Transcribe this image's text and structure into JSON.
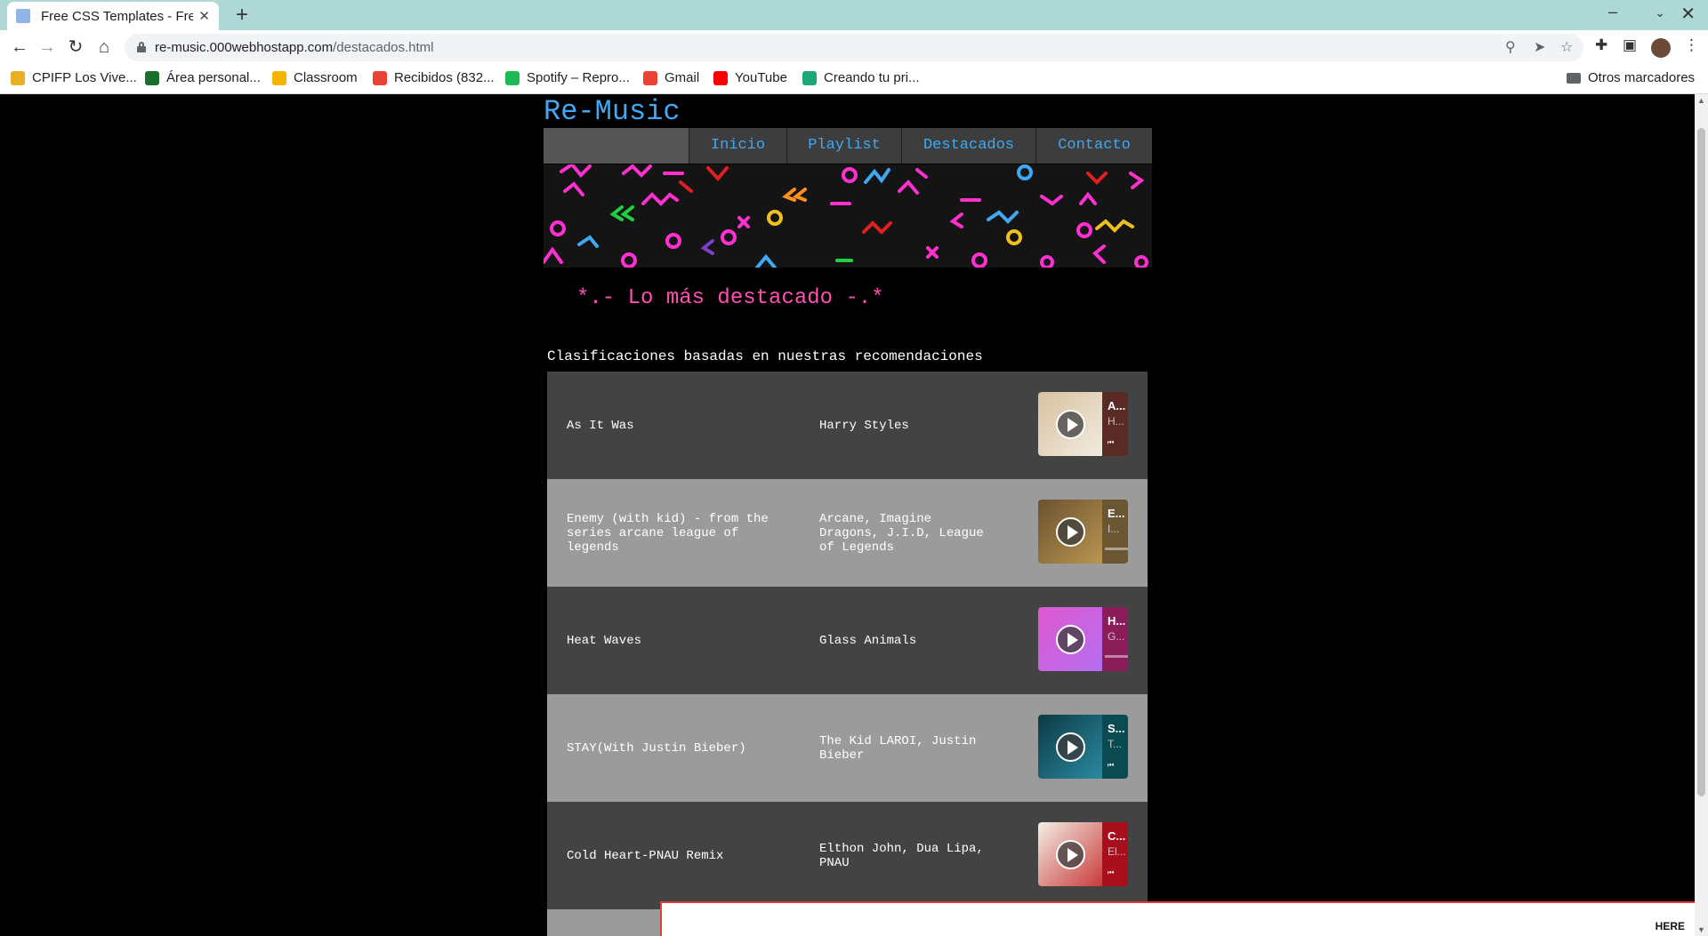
{
  "browser": {
    "tab_title": "Free CSS Templates - Free CSS",
    "new_tab": "+",
    "close": "✕",
    "url_host": "re-music.000webhostapp.com",
    "url_path": "/destacados.html",
    "bookmarks": [
      {
        "label": "CPIFP Los Vive...",
        "color": "#e8b020"
      },
      {
        "label": "Área personal...",
        "color": "#1a6e2e"
      },
      {
        "label": "Classroom",
        "color": "#f4b400"
      },
      {
        "label": "Recibidos (832...",
        "color": "#ea4335"
      },
      {
        "label": "Spotify – Repro...",
        "color": "#1db954"
      },
      {
        "label": "Gmail",
        "color": "#ea4335"
      },
      {
        "label": "YouTube",
        "color": "#ff0000"
      },
      {
        "label": "Creando tu pri...",
        "color": "#1ea77b"
      }
    ],
    "other_bookmarks": "Otros marcadores"
  },
  "site": {
    "logo": "Re-Music",
    "menu": [
      "Inicio",
      "Playlist",
      "Destacados",
      "Contacto"
    ],
    "section_title": "*.- Lo más destacado -.*",
    "table_caption": "Clasificaciones basadas en nuestras recomendaciones",
    "tracks": [
      {
        "title": "As It Was",
        "artist": "Harry Styles",
        "player_title": "A...",
        "player_sub": "H...",
        "cover": [
          "#d8c1a0",
          "#f2ebe0"
        ],
        "side_color": "#5a2a24"
      },
      {
        "title": "Enemy (with kid) - from the series arcane league of legends",
        "artist": "Arcane, Imagine Dragons, J.I.D, League of Legends",
        "player_title": "E...",
        "player_sub": "I...",
        "cover": [
          "#6b5230",
          "#b9954f"
        ],
        "side_color": "#6a5632"
      },
      {
        "title": "Heat Waves",
        "artist": "Glass Animals",
        "player_title": "H...",
        "player_sub": "G...",
        "cover": [
          "#e058d0",
          "#b46ef0"
        ],
        "side_color": "#8a1c5a"
      },
      {
        "title": "STAY(With Justin Bieber)",
        "artist": "The Kid LAROI, Justin Bieber",
        "player_title": "S...",
        "player_sub": "T...",
        "cover": [
          "#0d3a45",
          "#2a8aa0"
        ],
        "side_color": "#0c4a52"
      },
      {
        "title": "Cold Heart-PNAU Remix",
        "artist": "Elthon John, Dua Lipa, PNAU",
        "player_title": "C...",
        "player_sub": "El...",
        "cover": [
          "#f3eee5",
          "#c93a3a"
        ],
        "side_color": "#a80e1c"
      }
    ]
  },
  "cookie": {
    "link": "HERE"
  }
}
